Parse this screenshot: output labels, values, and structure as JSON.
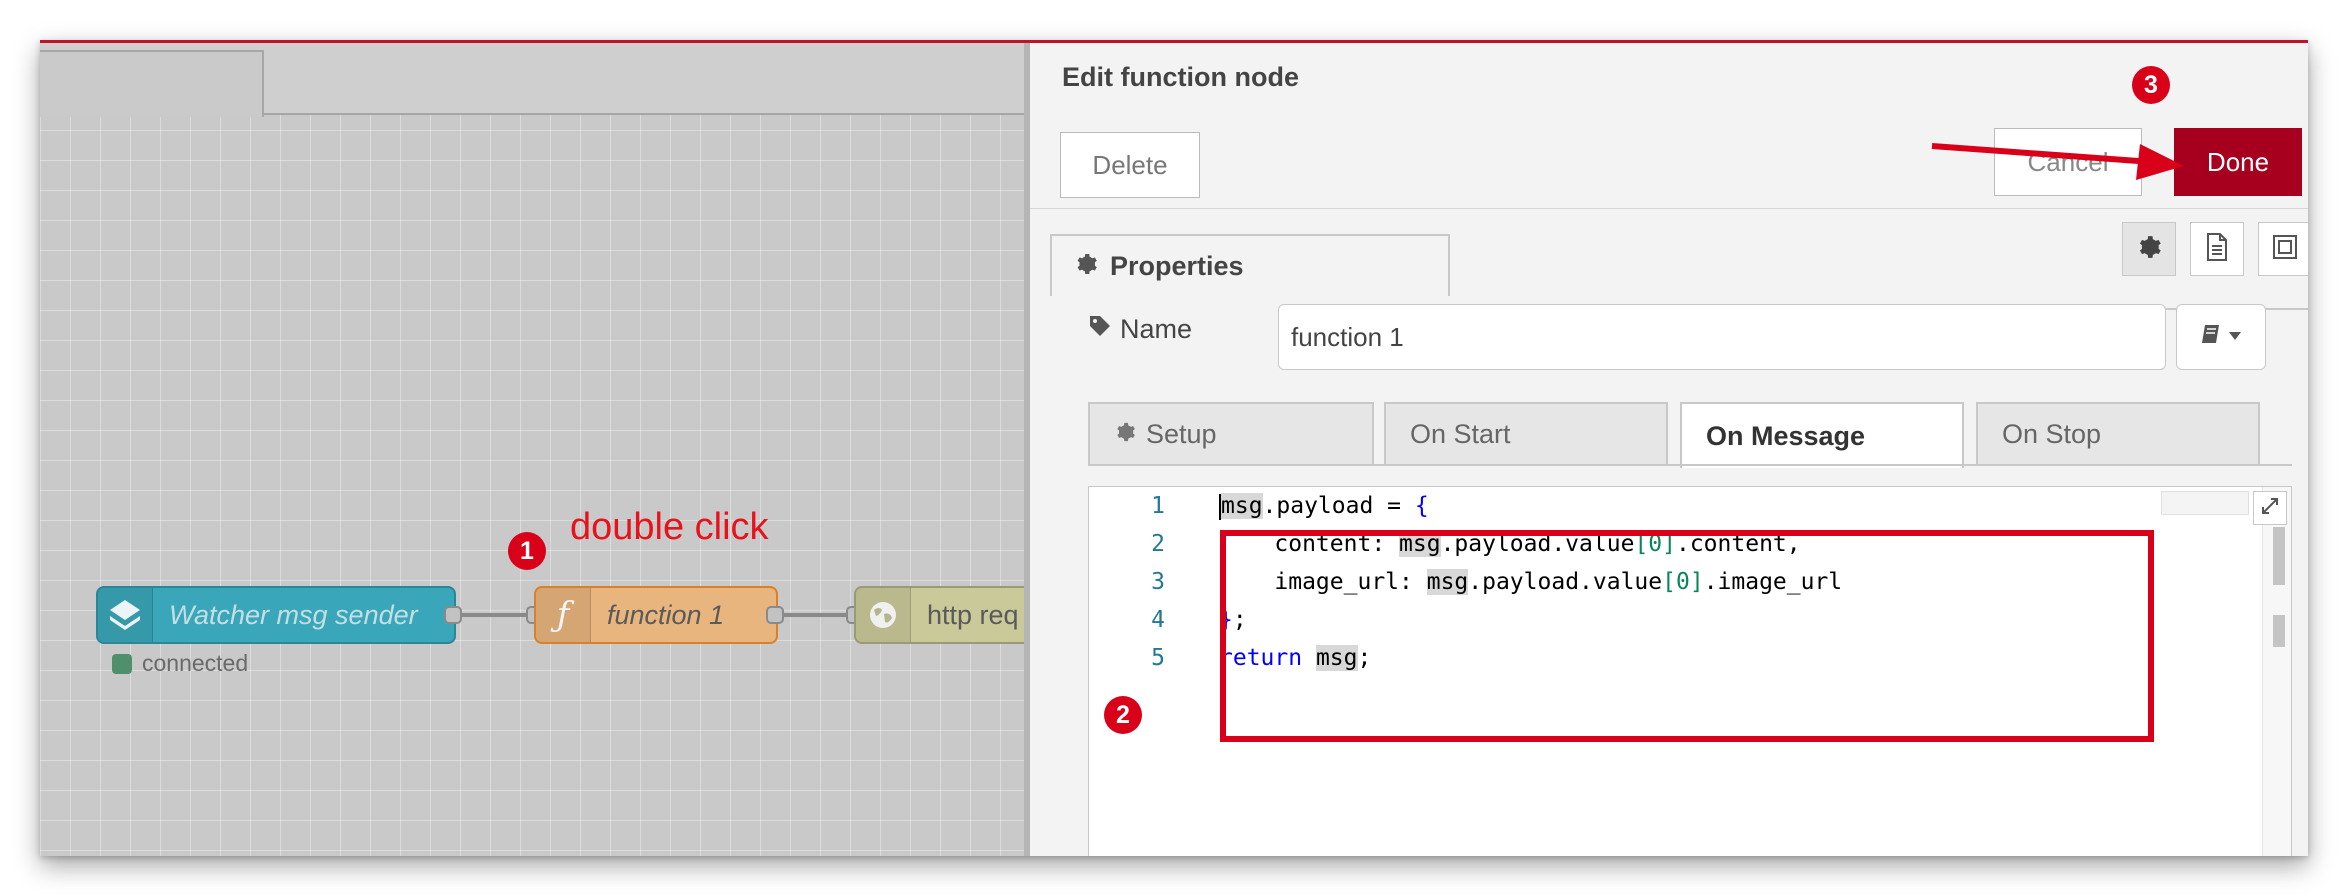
{
  "workspace": {
    "nodes": {
      "watcher_label": "Watcher msg sender",
      "watcher_status": "connected",
      "function_label": "function 1",
      "http_label": "http req"
    },
    "annotations": {
      "step1": "1",
      "step1_text": "double click",
      "step2": "2",
      "step3": "3"
    }
  },
  "tray": {
    "title": "Edit function node",
    "delete_label": "Delete",
    "cancel_label": "Cancel",
    "done_label": "Done",
    "properties_tab": "Properties",
    "name_label": "Name",
    "name_value": "function 1",
    "subtabs": [
      "Setup",
      "On Start",
      "On Message",
      "On Stop"
    ],
    "active_subtab": "On Message"
  },
  "editor": {
    "line_numbers": [
      "1",
      "2",
      "3",
      "4",
      "5"
    ],
    "code": [
      "msg.payload = {",
      "    content: msg.payload.value[0].content,",
      "    image_url: msg.payload.value[0].image_url",
      "};",
      "return msg;"
    ]
  },
  "colors": {
    "accent": "#a6001e",
    "annotation_red": "#d9011a",
    "watcher_node": "#3aa6b9",
    "function_node": "#fdd0a2",
    "http_node": "#e7e7ae"
  }
}
